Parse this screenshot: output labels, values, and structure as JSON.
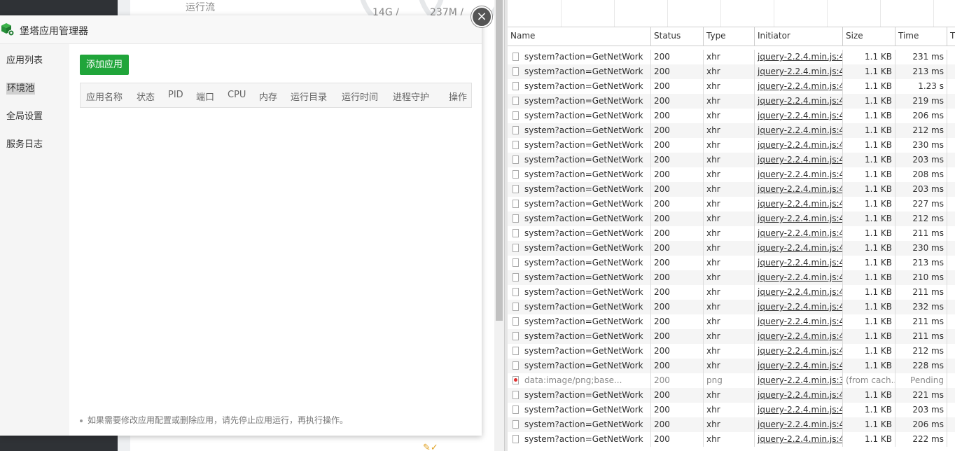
{
  "background_page": {
    "running_label": "运行流",
    "stat_1": "14G /",
    "stat_2": "237M /"
  },
  "modal": {
    "title": "堡塔应用管理器",
    "nav": [
      {
        "label": "应用列表",
        "active": false
      },
      {
        "label": "环境池",
        "active": true
      },
      {
        "label": "全局设置",
        "active": false
      },
      {
        "label": "服务日志",
        "active": false
      }
    ],
    "add_button": "添加应用",
    "columns": [
      "应用名称",
      "状态",
      "PID",
      "端口",
      "CPU",
      "内存",
      "运行目录",
      "运行时间",
      "进程守护",
      "操作"
    ],
    "footer_note": "如果需要修改应用配置或删除应用，请先停止应用运行，再执行操作。",
    "close_symbol": "×"
  },
  "devtools": {
    "columns": [
      "Name",
      "Status",
      "Type",
      "Initiator",
      "Size",
      "Time",
      "Ti"
    ],
    "rows": [
      {
        "name": "system?action=GetNetWork",
        "status": "200",
        "type": "xhr",
        "initiator": "jquery-2.2.4.min.js:4",
        "size": "1.1 KB",
        "time": "231 ms"
      },
      {
        "name": "system?action=GetNetWork",
        "status": "200",
        "type": "xhr",
        "initiator": "jquery-2.2.4.min.js:4",
        "size": "1.1 KB",
        "time": "213 ms"
      },
      {
        "name": "system?action=GetNetWork",
        "status": "200",
        "type": "xhr",
        "initiator": "jquery-2.2.4.min.js:4",
        "size": "1.1 KB",
        "time": "1.23 s"
      },
      {
        "name": "system?action=GetNetWork",
        "status": "200",
        "type": "xhr",
        "initiator": "jquery-2.2.4.min.js:4",
        "size": "1.1 KB",
        "time": "219 ms"
      },
      {
        "name": "system?action=GetNetWork",
        "status": "200",
        "type": "xhr",
        "initiator": "jquery-2.2.4.min.js:4",
        "size": "1.1 KB",
        "time": "206 ms"
      },
      {
        "name": "system?action=GetNetWork",
        "status": "200",
        "type": "xhr",
        "initiator": "jquery-2.2.4.min.js:4",
        "size": "1.1 KB",
        "time": "212 ms"
      },
      {
        "name": "system?action=GetNetWork",
        "status": "200",
        "type": "xhr",
        "initiator": "jquery-2.2.4.min.js:4",
        "size": "1.1 KB",
        "time": "230 ms"
      },
      {
        "name": "system?action=GetNetWork",
        "status": "200",
        "type": "xhr",
        "initiator": "jquery-2.2.4.min.js:4",
        "size": "1.1 KB",
        "time": "203 ms"
      },
      {
        "name": "system?action=GetNetWork",
        "status": "200",
        "type": "xhr",
        "initiator": "jquery-2.2.4.min.js:4",
        "size": "1.1 KB",
        "time": "208 ms"
      },
      {
        "name": "system?action=GetNetWork",
        "status": "200",
        "type": "xhr",
        "initiator": "jquery-2.2.4.min.js:4",
        "size": "1.1 KB",
        "time": "203 ms"
      },
      {
        "name": "system?action=GetNetWork",
        "status": "200",
        "type": "xhr",
        "initiator": "jquery-2.2.4.min.js:4",
        "size": "1.1 KB",
        "time": "227 ms"
      },
      {
        "name": "system?action=GetNetWork",
        "status": "200",
        "type": "xhr",
        "initiator": "jquery-2.2.4.min.js:4",
        "size": "1.1 KB",
        "time": "212 ms"
      },
      {
        "name": "system?action=GetNetWork",
        "status": "200",
        "type": "xhr",
        "initiator": "jquery-2.2.4.min.js:4",
        "size": "1.1 KB",
        "time": "211 ms"
      },
      {
        "name": "system?action=GetNetWork",
        "status": "200",
        "type": "xhr",
        "initiator": "jquery-2.2.4.min.js:4",
        "size": "1.1 KB",
        "time": "230 ms"
      },
      {
        "name": "system?action=GetNetWork",
        "status": "200",
        "type": "xhr",
        "initiator": "jquery-2.2.4.min.js:4",
        "size": "1.1 KB",
        "time": "213 ms"
      },
      {
        "name": "system?action=GetNetWork",
        "status": "200",
        "type": "xhr",
        "initiator": "jquery-2.2.4.min.js:4",
        "size": "1.1 KB",
        "time": "210 ms"
      },
      {
        "name": "system?action=GetNetWork",
        "status": "200",
        "type": "xhr",
        "initiator": "jquery-2.2.4.min.js:4",
        "size": "1.1 KB",
        "time": "211 ms"
      },
      {
        "name": "system?action=GetNetWork",
        "status": "200",
        "type": "xhr",
        "initiator": "jquery-2.2.4.min.js:4",
        "size": "1.1 KB",
        "time": "232 ms"
      },
      {
        "name": "system?action=GetNetWork",
        "status": "200",
        "type": "xhr",
        "initiator": "jquery-2.2.4.min.js:4",
        "size": "1.1 KB",
        "time": "211 ms"
      },
      {
        "name": "system?action=GetNetWork",
        "status": "200",
        "type": "xhr",
        "initiator": "jquery-2.2.4.min.js:4",
        "size": "1.1 KB",
        "time": "211 ms"
      },
      {
        "name": "system?action=GetNetWork",
        "status": "200",
        "type": "xhr",
        "initiator": "jquery-2.2.4.min.js:4",
        "size": "1.1 KB",
        "time": "212 ms"
      },
      {
        "name": "system?action=GetNetWork",
        "status": "200",
        "type": "xhr",
        "initiator": "jquery-2.2.4.min.js:4",
        "size": "1.1 KB",
        "time": "228 ms"
      },
      {
        "name": "data:image/png;base...",
        "status": "200",
        "type": "png",
        "initiator": "jquery-2.2.4.min.js:3",
        "size": "(from cach...",
        "time": "Pending",
        "icon": "image-file-icon",
        "dim": true
      },
      {
        "name": "system?action=GetNetWork",
        "status": "200",
        "type": "xhr",
        "initiator": "jquery-2.2.4.min.js:4",
        "size": "1.1 KB",
        "time": "221 ms"
      },
      {
        "name": "system?action=GetNetWork",
        "status": "200",
        "type": "xhr",
        "initiator": "jquery-2.2.4.min.js:4",
        "size": "1.1 KB",
        "time": "203 ms"
      },
      {
        "name": "system?action=GetNetWork",
        "status": "200",
        "type": "xhr",
        "initiator": "jquery-2.2.4.min.js:4",
        "size": "1.1 KB",
        "time": "206 ms"
      },
      {
        "name": "system?action=GetNetWork",
        "status": "200",
        "type": "xhr",
        "initiator": "jquery-2.2.4.min.js:4",
        "size": "1.1 KB",
        "time": "222 ms"
      }
    ]
  },
  "colors": {
    "accent_green": "#20a53a",
    "dark_sidebar": "#2f3236",
    "close_button": "#555555",
    "image_icon_red": "#e03030"
  }
}
